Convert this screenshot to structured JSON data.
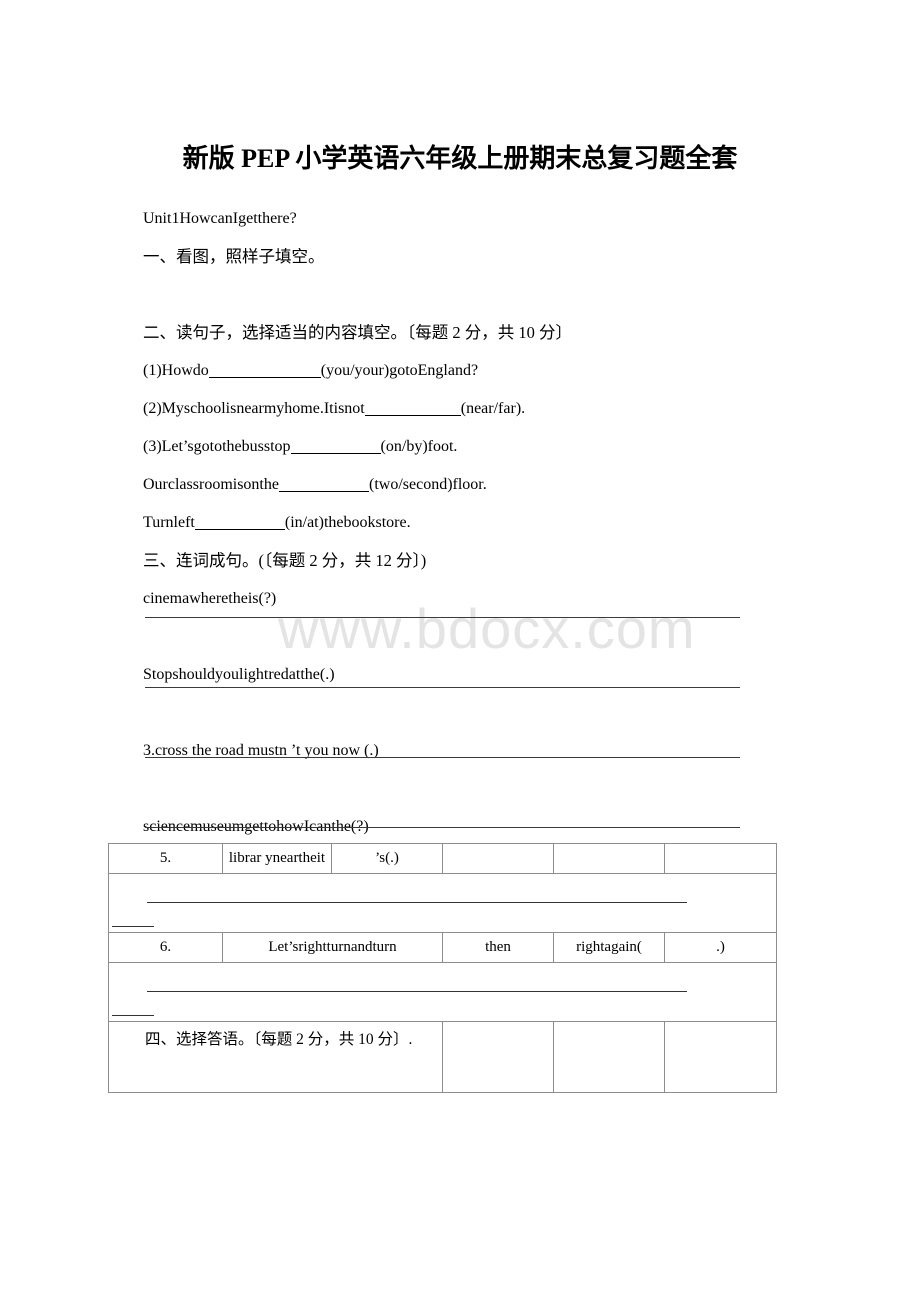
{
  "document": {
    "title": "新版 PEP 小学英语六年级上册期末总复习题全套",
    "watermark": "www.bdocx.com"
  },
  "body": {
    "unit_heading": "Unit1HowcanIgetthere?",
    "section_one": "一、看图，照样子填空。",
    "section_two": "二、读句子，选择适当的内容填空。〔每题 2 分，共 10 分〕",
    "fill_items": [
      {
        "pre": "(1)Howdo",
        "post": "(you/your)gotoEngland?"
      },
      {
        "pre": "(2)Myschoolisnearmyhome.Itisnot",
        "post": "(near/far)."
      },
      {
        "pre": "(3)Let’sgotothebusstop",
        "post": "(on/by)foot."
      },
      {
        "pre": "Ourclassroomisonthe",
        "post": "(two/second)floor."
      },
      {
        "pre": "Turnleft",
        "post": "(in/at)thebookstore."
      }
    ],
    "section_three": "三、连词成句。(〔每题 2 分，共 12 分〕)",
    "scramble_items": [
      "cinemawheretheis(?)",
      "Stopshouldyoulightredatthe(.)",
      "3.cross the road mustn ’t you now (.)",
      "sciencemuseumgettohowIcanthe(?)"
    ]
  },
  "table": {
    "row5": {
      "number": "5.",
      "cell2": "librar yneartheit",
      "cell3": "’s(.)",
      "cell4": "",
      "cell5": "",
      "cell6": ""
    },
    "row6": {
      "number": "6.",
      "cell2": "Let’srightturnandturn",
      "cell3": "then",
      "cell4": "rightagain(",
      "cell5": ".)"
    },
    "section_four": "四、选择答语。〔每题 2 分，共 10 分〕."
  }
}
